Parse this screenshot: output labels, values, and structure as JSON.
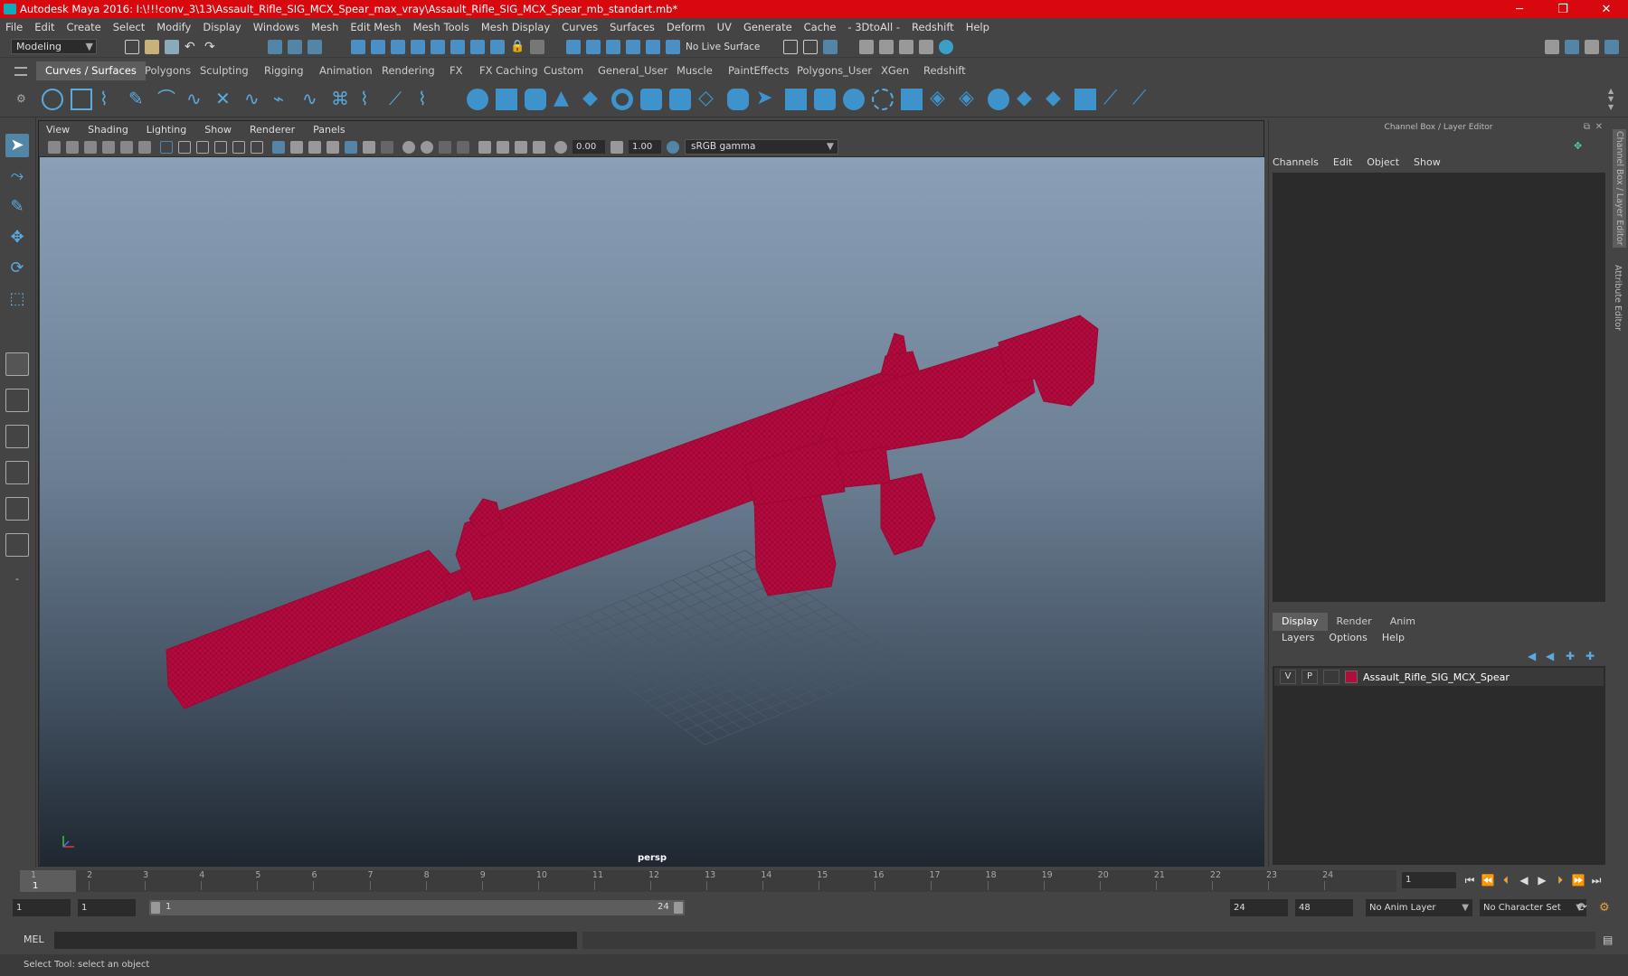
{
  "window": {
    "title": "Autodesk Maya 2016: I:\\!!!conv_3\\13\\Assault_Rifle_SIG_MCX_Spear_max_vray\\Assault_Rifle_SIG_MCX_Spear_mb_standart.mb*",
    "minimize": "─",
    "restore": "❐",
    "close": "✕"
  },
  "menu": [
    "File",
    "Edit",
    "Create",
    "Select",
    "Modify",
    "Display",
    "Windows",
    "Mesh",
    "Edit Mesh",
    "Mesh Tools",
    "Mesh Display",
    "Curves",
    "Surfaces",
    "Deform",
    "UV",
    "Generate",
    "Cache",
    "- 3DtoAll -",
    "Redshift",
    "Help"
  ],
  "status": {
    "mode": "Modeling",
    "live_surface": "No Live Surface"
  },
  "shelf_tabs": [
    "Curves / Surfaces",
    "Polygons",
    "Sculpting",
    "Rigging",
    "Animation",
    "Rendering",
    "FX",
    "FX Caching",
    "Custom",
    "General_User",
    "Muscle",
    "PaintEffects",
    "Polygons_User",
    "XGen",
    "Redshift"
  ],
  "viewport": {
    "menu": [
      "View",
      "Shading",
      "Lighting",
      "Show",
      "Renderer",
      "Panels"
    ],
    "exposure": "0.00",
    "gamma": "1.00",
    "color_space": "sRGB gamma",
    "camera": "persp"
  },
  "channel_box": {
    "title": "Channel Box / Layer Editor",
    "menu": [
      "Channels",
      "Edit",
      "Object",
      "Show"
    ]
  },
  "layer_editor": {
    "tabs": [
      "Display",
      "Render",
      "Anim"
    ],
    "menu": [
      "Layers",
      "Options",
      "Help"
    ],
    "layer": {
      "v": "V",
      "p": "P",
      "name": "Assault_Rifle_SIG_MCX_Spear",
      "color": "#b00e3a"
    }
  },
  "side_tabs": [
    "Channel Box / Layer Editor",
    "Attribute Editor"
  ],
  "timeline": {
    "ticks": [
      "1",
      "2",
      "3",
      "4",
      "5",
      "6",
      "7",
      "8",
      "9",
      "10",
      "11",
      "12",
      "13",
      "14",
      "15",
      "16",
      "17",
      "18",
      "19",
      "20",
      "21",
      "22",
      "23",
      "24"
    ],
    "current": "1",
    "frame_field": "1"
  },
  "range": {
    "start": "1",
    "start2": "1",
    "slider_start": "1",
    "slider_end": "24",
    "end": "24",
    "end2": "48",
    "anim_layer": "No Anim Layer",
    "char_set": "No Character Set"
  },
  "mel": {
    "label": "MEL"
  },
  "help_line": "Select Tool: select an object",
  "colors": {
    "titlebar": "#d7080e",
    "accent": "#5285a6",
    "model": "#b00e3a"
  }
}
